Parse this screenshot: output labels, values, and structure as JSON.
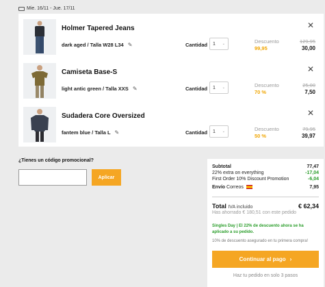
{
  "delivery": {
    "text": "Mie. 16/11 - Jue. 17/11"
  },
  "cart": {
    "items": [
      {
        "name": "Holmer Tapered Jeans",
        "variant": "dark aged / Talla W28 L34",
        "qty_label": "Cantidad",
        "qty": "1",
        "discount_label": "Descuento",
        "discount_value": "99,95",
        "old_price": "129,95",
        "new_price": "30,00"
      },
      {
        "name": "Camiseta Base-S",
        "variant": "light antic green / Talla XXS",
        "qty_label": "Cantidad",
        "qty": "1",
        "discount_label": "Descuento",
        "discount_value": "70 %",
        "old_price": "25,00",
        "new_price": "7,50"
      },
      {
        "name": "Sudadera Core Oversized",
        "variant": "fantem blue / Talla L",
        "qty_label": "Cantidad",
        "qty": "1",
        "discount_label": "Descuento",
        "discount_value": "50 %",
        "old_price": "79,95",
        "new_price": "39,97"
      }
    ]
  },
  "promo": {
    "title": "¿Tienes un código promocional?",
    "placeholder": "",
    "button": "Aplicar"
  },
  "summary": {
    "subtotal_label": "Subtotal",
    "subtotal_value": "77,47",
    "extra_label": "22% extra on everything",
    "extra_value": "-17,04",
    "firstorder_label": "First Order 10% Discount Promotion",
    "firstorder_value": "-6,04",
    "shipping_label": "Envío",
    "shipping_carrier": "Correos",
    "shipping_value": "7,95",
    "total_label": "Total",
    "total_sub": "IVA incluido",
    "total_value": "€ 62,34",
    "saved": "Has ahorrado € 180,51 con este pedido",
    "singles_day": "Singles Day | El 22% de descuento ahora se ha aplicado a su pedido.",
    "first_order_note": "10% de descuento asegurado en tu primera compra!",
    "checkout": "Continuar al pago",
    "steps": "Haz tu pedido en solo 3 pasos"
  },
  "colors": {
    "accent": "#f5a623",
    "discount": "#f0a500",
    "green": "#2a9d2a"
  }
}
